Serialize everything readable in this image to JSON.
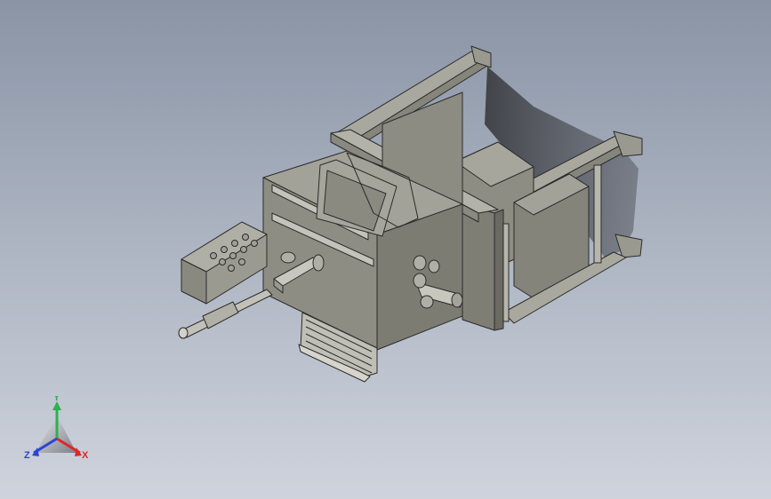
{
  "viewport": {
    "background_top": "#8a94a5",
    "background_bottom": "#cfd3dc",
    "model_color": "#8e8d83",
    "model_edge_color": "#2b2b2b"
  },
  "triad": {
    "x_label": "X",
    "y_label": "Y",
    "z_label": "Z",
    "x_color": "#e0262a",
    "y_color": "#2bb24c",
    "z_color": "#2a44d8"
  }
}
